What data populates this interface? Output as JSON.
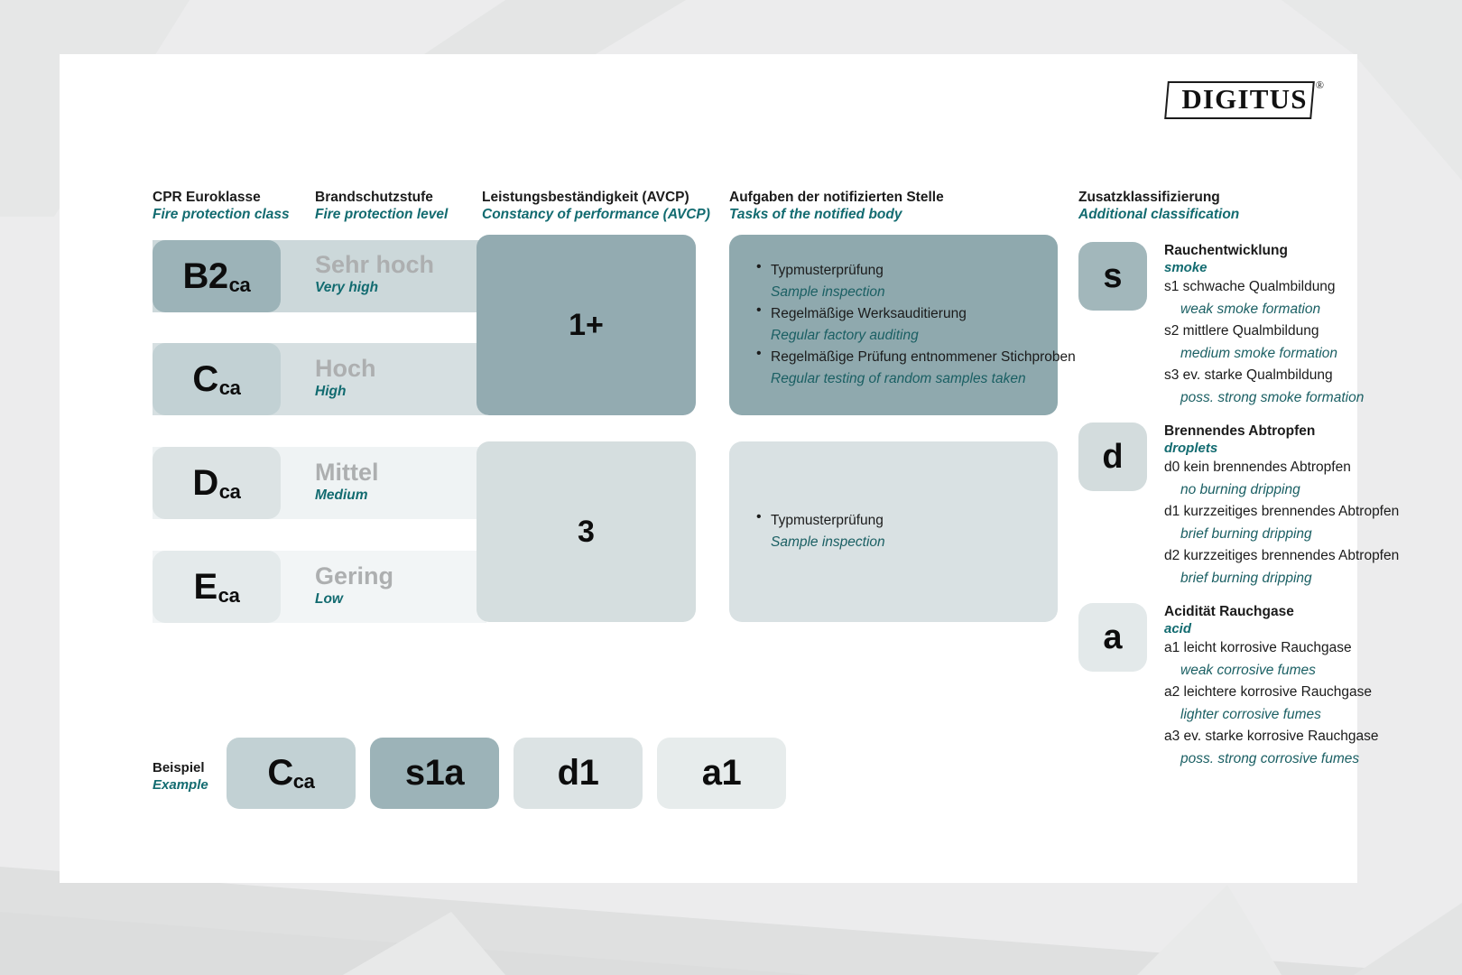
{
  "logo": {
    "text": "DIGITUS",
    "registered": "®"
  },
  "palette": {
    "band_1": "#ccd8da",
    "band_2": "#d6dfe1",
    "band_3": "#eff3f4",
    "band_4": "#f2f5f6",
    "chip_b2": "#9cb3b8",
    "chip_c": "#c2d1d4",
    "chip_d": "#dce3e4",
    "chip_e": "#e4eaeb",
    "avcp_1plus": "#93abb1",
    "avcp_3": "#d5dedf",
    "tasks_top": "#8fa9ae",
    "tasks_bottom": "#d9e1e3",
    "badge_s": "#a2b7bb",
    "badge_d": "#d3dcdd",
    "badge_a": "#e3e9ea",
    "teal": "#126b70",
    "teal_dark": "#1a5f63",
    "gray_level": "#adafb0",
    "page_bg": "#ececed",
    "card_bg": "#ffffff"
  },
  "headers": [
    {
      "de": "CPR Euroklasse",
      "en": "Fire protection class"
    },
    {
      "de": "Brandschutzstufe",
      "en": "Fire protection level"
    },
    {
      "de": "Leistungsbeständigkeit (AVCP)",
      "en": "Constancy of performance (AVCP)"
    },
    {
      "de": "Aufgaben der notifizierten Stelle",
      "en": "Tasks of the notified body"
    },
    {
      "de": "Zusatzklassifizierung",
      "en": "Additional classification"
    }
  ],
  "classes": [
    {
      "letter": "B2",
      "sub": "ca",
      "level_de": "Sehr hoch",
      "level_en": "Very high"
    },
    {
      "letter": "C",
      "sub": "ca",
      "level_de": "Hoch",
      "level_en": "High"
    },
    {
      "letter": "D",
      "sub": "ca",
      "level_de": "Mittel",
      "level_en": "Medium"
    },
    {
      "letter": "E",
      "sub": "ca",
      "level_de": "Gering",
      "level_en": "Low"
    }
  ],
  "avcp": [
    {
      "value": "1+"
    },
    {
      "value": "3"
    }
  ],
  "tasks": [
    {
      "items": [
        {
          "de": "Typmusterprüfung",
          "en": "Sample inspection"
        },
        {
          "de": "Regelmäßige Werksauditierung",
          "en": "Regular factory auditing"
        },
        {
          "de": "Regelmäßige Prüfung entnommener Stichproben",
          "en": "Regular testing of random samples taken"
        }
      ]
    },
    {
      "items": [
        {
          "de": "Typmusterprüfung",
          "en": "Sample inspection"
        }
      ]
    }
  ],
  "additional": [
    {
      "badge": "s",
      "title_de": "Rauchentwicklung",
      "title_en": "smoke",
      "items": [
        {
          "de": "s1 schwache Qualmbildung",
          "en": "weak smoke formation"
        },
        {
          "de": "s2 mittlere Qualmbildung",
          "en": "medium smoke formation"
        },
        {
          "de": "s3 ev. starke Qualmbildung",
          "en": "poss. strong smoke formation"
        }
      ]
    },
    {
      "badge": "d",
      "title_de": "Brennendes Abtropfen",
      "title_en": "droplets",
      "items": [
        {
          "de": "d0 kein brennendes Abtropfen",
          "en": "no burning dripping"
        },
        {
          "de": "d1 kurzzeitiges brennendes Abtropfen",
          "en": "brief burning dripping"
        },
        {
          "de": "d2 kurzzeitiges brennendes Abtropfen",
          "en": "brief burning dripping"
        }
      ]
    },
    {
      "badge": "a",
      "title_de": "Acidität Rauchgase",
      "title_en": "acid",
      "items": [
        {
          "de": "a1 leicht korrosive Rauchgase",
          "en": "weak corrosive fumes"
        },
        {
          "de": "a2 leichtere korrosive Rauchgase",
          "en": "lighter corrosive fumes"
        },
        {
          "de": "a3 ev. starke korrosive Rauchgase",
          "en": "poss. strong corrosive fumes"
        }
      ]
    }
  ],
  "example": {
    "label_de": "Beispiel",
    "label_en": "Example",
    "boxes": [
      {
        "big": "C",
        "sub": "ca"
      },
      {
        "big": "s1a",
        "sub": ""
      },
      {
        "big": "d1",
        "sub": ""
      },
      {
        "big": "a1",
        "sub": ""
      }
    ]
  }
}
